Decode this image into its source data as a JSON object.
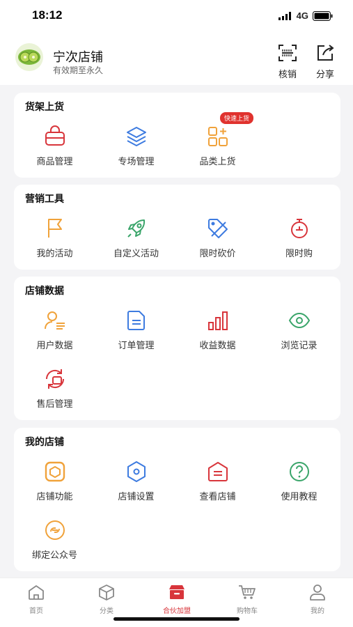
{
  "status": {
    "time": "18:12",
    "network": "4G"
  },
  "header": {
    "shop_name": "宁次店铺",
    "validity": "有效期至永久",
    "verify_label": "核销",
    "share_label": "分享"
  },
  "sections": {
    "shelf": {
      "title": "货架上货",
      "badge": "快速上货",
      "items": [
        {
          "label": "商品管理",
          "icon": "bag-icon"
        },
        {
          "label": "专场管理",
          "icon": "layers-icon"
        },
        {
          "label": "品类上货",
          "icon": "category-grid-icon"
        }
      ]
    },
    "marketing": {
      "title": "营销工具",
      "items": [
        {
          "label": "我的活动",
          "icon": "flag-icon"
        },
        {
          "label": "自定义活动",
          "icon": "rocket-icon"
        },
        {
          "label": "限时砍价",
          "icon": "price-tag-cut-icon"
        },
        {
          "label": "限时购",
          "icon": "stopwatch-icon"
        }
      ]
    },
    "data": {
      "title": "店铺数据",
      "items": [
        {
          "label": "用户数据",
          "icon": "user-list-icon"
        },
        {
          "label": "订单管理",
          "icon": "document-icon"
        },
        {
          "label": "收益数据",
          "icon": "bar-chart-icon"
        },
        {
          "label": "浏览记录",
          "icon": "eye-icon"
        },
        {
          "label": "售后管理",
          "icon": "refresh-box-icon"
        }
      ]
    },
    "myshop": {
      "title": "我的店铺",
      "items": [
        {
          "label": "店铺功能",
          "icon": "box-icon"
        },
        {
          "label": "店铺设置",
          "icon": "hexagon-settings-icon"
        },
        {
          "label": "查看店铺",
          "icon": "storefront-icon"
        },
        {
          "label": "使用教程",
          "icon": "help-circle-icon"
        },
        {
          "label": "绑定公众号",
          "icon": "link-icon"
        }
      ]
    }
  },
  "tabbar": {
    "items": [
      {
        "label": "首页",
        "icon": "home-icon"
      },
      {
        "label": "分类",
        "icon": "cube-icon"
      },
      {
        "label": "合伙加盟",
        "icon": "shop-icon",
        "active": true
      },
      {
        "label": "购物车",
        "icon": "cart-icon"
      },
      {
        "label": "我的",
        "icon": "person-icon"
      }
    ]
  },
  "colors": {
    "red": "#d8353b",
    "blue": "#3d7be0",
    "orange": "#f0a23a",
    "green": "#3aa56a"
  }
}
